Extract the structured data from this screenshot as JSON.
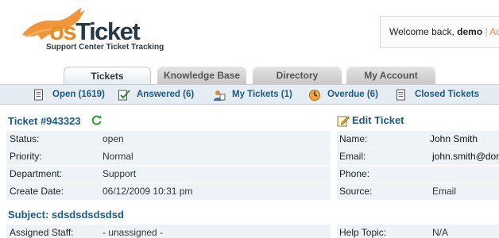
{
  "brand": {
    "logo_os": "os",
    "logo_ticket": "Ticket",
    "tagline": "Support Center Ticket Tracking",
    "accent_color": "#ee8a22"
  },
  "welcome": {
    "prefix": "Welcome back, ",
    "user": "demo",
    "separator": " | ",
    "admin_link": "Admin Panel"
  },
  "tabs": [
    {
      "label": "Tickets",
      "active": true
    },
    {
      "label": "Knowledge Base",
      "active": false
    },
    {
      "label": "Directory",
      "active": false
    },
    {
      "label": "My Account",
      "active": false
    }
  ],
  "subnav": [
    {
      "label": "Open (1619)",
      "icon": "open-tickets-icon"
    },
    {
      "label": "Answered (6)",
      "icon": "answered-icon"
    },
    {
      "label": "My Tickets (1)",
      "icon": "my-tickets-icon"
    },
    {
      "label": "Overdue (6)",
      "icon": "overdue-icon"
    },
    {
      "label": "Closed Tickets",
      "icon": "closed-tickets-icon"
    }
  ],
  "ticket": {
    "title": "Ticket #943323",
    "edit_label": "Edit Ticket",
    "subject": "Subject: sdsdsdsdsdsd",
    "left_fields": [
      {
        "label": "Status:",
        "value": "open"
      },
      {
        "label": "Priority:",
        "value": "Normal"
      },
      {
        "label": "Department:",
        "value": "Support"
      },
      {
        "label": "Create Date:",
        "value": "06/12/2009 10:31 pm"
      }
    ],
    "right_fields": [
      {
        "label": "Name:",
        "value": "John Smith"
      },
      {
        "label": "Email:",
        "value": "john.smith@domain.com"
      },
      {
        "label": "Phone:",
        "value": ""
      },
      {
        "label": "Source:",
        "value": "Email"
      }
    ],
    "assigned": {
      "label": "Assigned Staff:",
      "value": "- unassigned -"
    },
    "help_topic": {
      "label": "Help Topic:",
      "value": "N/A"
    }
  }
}
